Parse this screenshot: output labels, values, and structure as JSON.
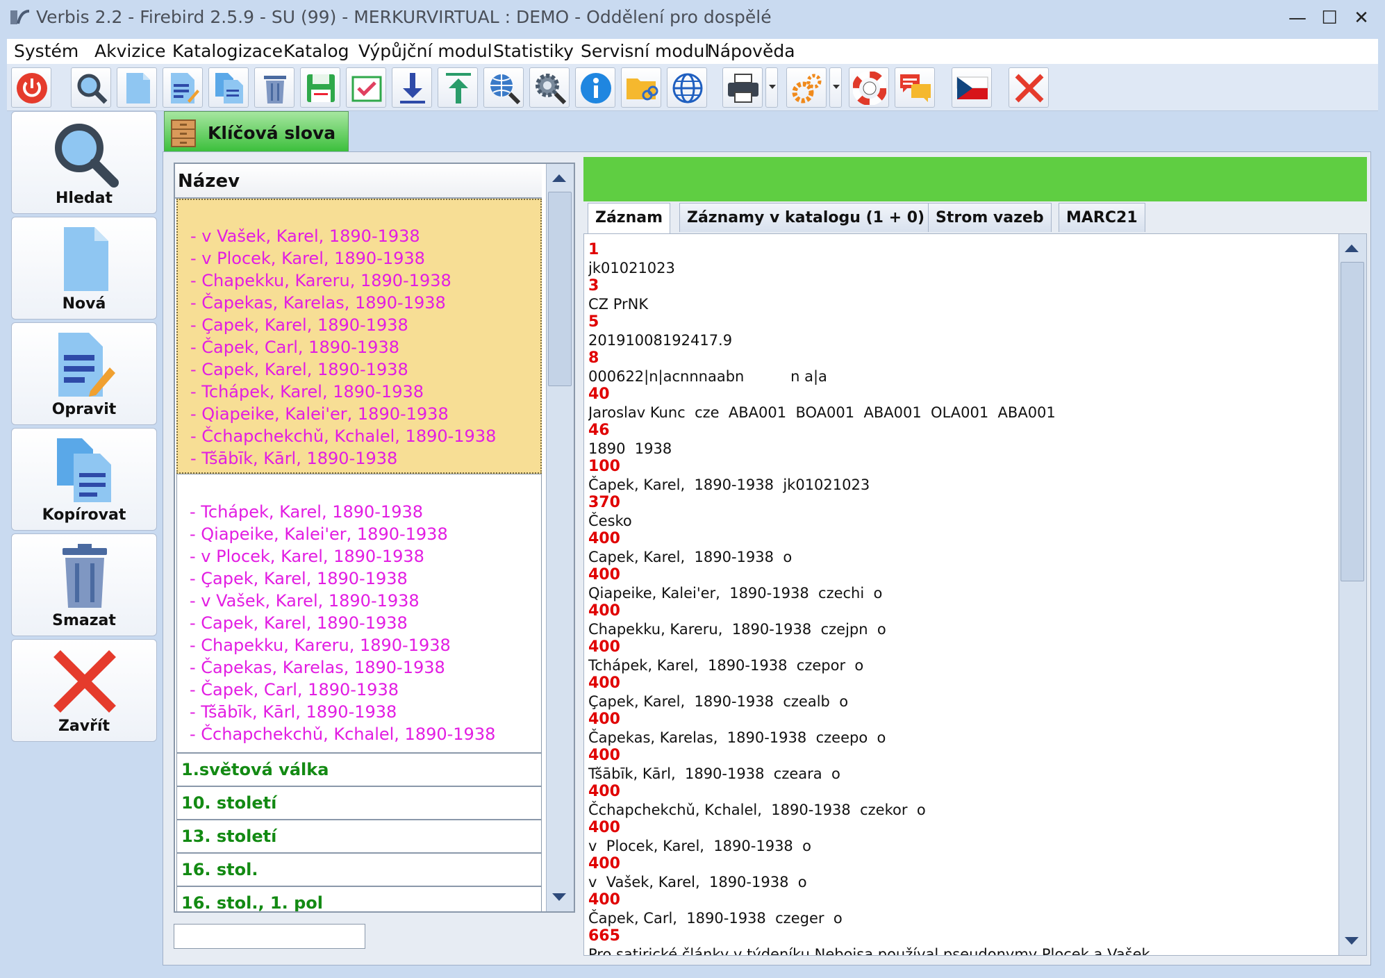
{
  "window": {
    "title": "Verbis 2.2 - Firebird 2.5.9 - SU (99) - MERKURVIRTUAL : DEMO - Oddělení pro dospělé",
    "minimize": "—",
    "maximize": "☐",
    "close": "✕"
  },
  "menu": [
    "Systém",
    "Akvizice",
    "Katalogizace",
    "Katalog",
    "Výpůjční modul",
    "Statistiky",
    "Servisní modul",
    "Nápověda"
  ],
  "toolbar_icons": [
    "power-icon",
    "search-icon",
    "new-document-icon",
    "edit-document-icon",
    "copy-document-icon",
    "trash-icon",
    "save-icon",
    "check-icon",
    "download-icon",
    "upload-icon",
    "web-search-icon",
    "settings-search-icon",
    "info-icon",
    "folder-link-icon",
    "globe-icon",
    "printer-icon",
    "gears-icon",
    "lifebuoy-icon",
    "chat-icon",
    "czech-flag-icon",
    "close-icon"
  ],
  "side_buttons": {
    "search": "Hledat",
    "new": "Nová",
    "edit": "Opravit",
    "copy": "Kopírovat",
    "delete": "Smazat",
    "close": "Zavřít"
  },
  "main_tab": {
    "label": "Klíčová slova"
  },
  "list": {
    "column_header": "Název",
    "selected_group": [
      "- v Vašek, Karel, 1890-1938",
      "- v Plocek, Karel, 1890-1938",
      "- Chapekku, Kareru, 1890-1938",
      "- Čapekas, Karelas, 1890-1938",
      "- Çapek, Karel, 1890-1938",
      "- Čapek, Carl, 1890-1938",
      "- Capek, Karel, 1890-1938",
      "- Tchápek, Karel, 1890-1938",
      "- Qiapeike, Kalei'er, 1890-1938",
      "- Čchapchekchǔ, Kchalel, 1890-1938",
      "- Tšābīk, Kārl, 1890-1938"
    ],
    "second_group": [
      "- Tchápek, Karel, 1890-1938",
      "- Qiapeike, Kalei'er, 1890-1938",
      "- v Plocek, Karel, 1890-1938",
      "- Çapek, Karel, 1890-1938",
      "- v Vašek, Karel, 1890-1938",
      "- Capek, Karel, 1890-1938",
      "- Chapekku, Kareru, 1890-1938",
      "- Čapekas, Karelas, 1890-1938",
      "- Čapek, Carl, 1890-1938",
      "- Tšābīk, Kārl, 1890-1938",
      "- Čchapchekchǔ, Kchalel, 1890-1938"
    ],
    "keywords": [
      "1.světová válka",
      "10. století",
      "13. století",
      "16. stol.",
      "16. stol., 1. pol"
    ],
    "search_value": ""
  },
  "record_tabs": [
    "Záznam",
    "Záznamy v katalogu (1 + 0)",
    "Strom vazeb",
    "MARC21"
  ],
  "record": [
    {
      "tag": "1",
      "value": "jk01021023"
    },
    {
      "tag": "3",
      "value": "CZ PrNK"
    },
    {
      "tag": "5",
      "value": "20191008192417.9"
    },
    {
      "tag": "8",
      "value": "000622|n|acnnnaabn          n a|a"
    },
    {
      "tag": "40",
      "value": "Jaroslav Kunc  cze  ABA001  BOA001  ABA001  OLA001  ABA001"
    },
    {
      "tag": "46",
      "value": "1890  1938"
    },
    {
      "tag": "100",
      "value": "Čapek, Karel,  1890-1938  jk01021023"
    },
    {
      "tag": "370",
      "value": "Česko"
    },
    {
      "tag": "400",
      "value": "Capek, Karel,  1890-1938  o"
    },
    {
      "tag": "400",
      "value": "Qiapeike, Kalei'er,  1890-1938  czechi  o"
    },
    {
      "tag": "400",
      "value": "Chapekku, Kareru,  1890-1938  czejpn  o"
    },
    {
      "tag": "400",
      "value": "Tchápek, Karel,  1890-1938  czepor  o"
    },
    {
      "tag": "400",
      "value": "Çapek, Karel,  1890-1938  czealb  o"
    },
    {
      "tag": "400",
      "value": "Čapekas, Karelas,  1890-1938  czeepo  o"
    },
    {
      "tag": "400",
      "value": "Tšābīk, Kārl,  1890-1938  czeara  o"
    },
    {
      "tag": "400",
      "value": "Čchapchekchǔ, Kchalel,  1890-1938  czekor  o"
    },
    {
      "tag": "400",
      "value": "v  Plocek, Karel,  1890-1938  o"
    },
    {
      "tag": "400",
      "value": "v  Vašek, Karel,  1890-1938  o"
    },
    {
      "tag": "400",
      "value": "Čapek, Carl,  1890-1938  czeger  o"
    },
    {
      "tag": "665",
      "value": "Pro satirické články v týdeníku Nebojsa používal pseudonymy Plocek a Vašek"
    }
  ],
  "colors": {
    "green_bar": "#5fce42",
    "selected_group_bg": "#f7de95",
    "variant_text": "#e21de2",
    "keyword_text": "#138a13",
    "marc_tag": "#e00000"
  }
}
